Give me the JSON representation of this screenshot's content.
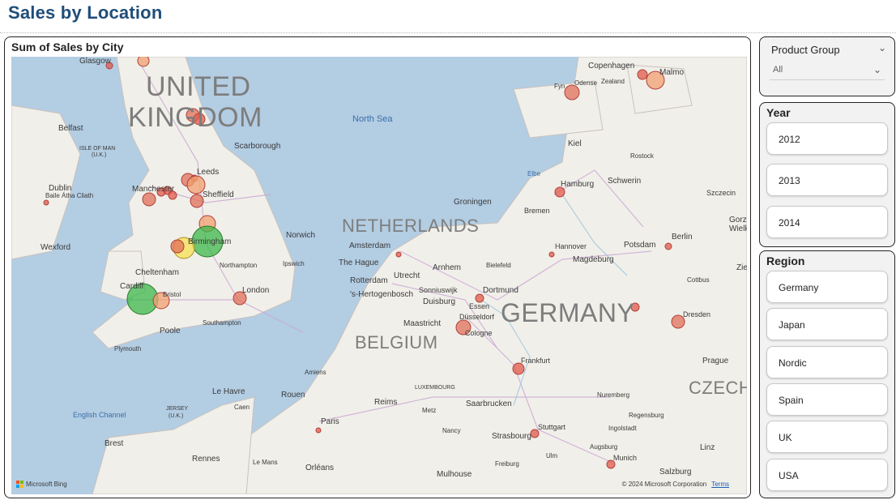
{
  "page_title": "Sales by Location",
  "map": {
    "title": "Sum of Sales by City",
    "attribution": "Microsoft Bing",
    "copyright": "© 2024 Microsoft Corporation",
    "terms": "Terms",
    "country_labels": [
      "UNITED",
      "KINGDOM",
      "NETHERLANDS",
      "BELGIUM",
      "GERMANY",
      "CZECH"
    ],
    "sea_labels": [
      "North Sea",
      "English Channel"
    ],
    "place_labels": [
      "Glasgow",
      "Belfast",
      "ISLE OF MAN",
      "(U.K.)",
      "Dublin",
      "Baile Átha Cliath",
      "Wexford",
      "Leeds",
      "Manchester",
      "Sheffield",
      "Scarborough",
      "Birmingham",
      "Norwich",
      "Northampton",
      "Ipswich",
      "Cheltenham",
      "Cardiff",
      "Bristol",
      "London",
      "Poole",
      "Southampton",
      "Plymouth",
      "Amsterdam",
      "The Hague",
      "Rotterdam",
      "Utrecht",
      "Arnhem",
      "Bielefeld",
      "'s-Hertogenbosch",
      "Sonniuswijk",
      "Dortmund",
      "Duisburg",
      "Essen",
      "Düsseldorf",
      "Maastricht",
      "Cologne",
      "Groningen",
      "Bremen",
      "Hamburg",
      "Hannover",
      "Magdeburg",
      "Potsdam",
      "Berlin",
      "Schwerin",
      "Rostock",
      "Kiel",
      "Elbe",
      "Szczecin",
      "Gorzów Wielkopolski",
      "Zielona",
      "Cottbus",
      "Dresden",
      "Odense",
      "Fyn",
      "Zealand",
      "Copenhagen",
      "Malmo",
      "Frankfurt",
      "Stuttgart",
      "Nuremberg",
      "Regensburg",
      "Ingolstadt",
      "Augsburg",
      "Munich",
      "Salzburg",
      "Linz",
      "Prague",
      "Amiens",
      "Le Havre",
      "Rouen",
      "Caen",
      "JERSEY",
      "(U.K.)",
      "Reims",
      "LUXEMBOURG",
      "Saarbrucken",
      "Metz",
      "Nancy",
      "Paris",
      "Strasbourg",
      "Freiburg",
      "Ulm",
      "Mulhouse",
      "Brest",
      "Rennes",
      "Le Mans",
      "Orléans"
    ],
    "bubble_colors": {
      "low": "#e05a4a",
      "mid": "#f0a070",
      "high": "#f5e050",
      "top": "#3cb84a"
    }
  },
  "product_group": {
    "label": "Product Group",
    "value": "All"
  },
  "year": {
    "label": "Year",
    "options": [
      "2012",
      "2013",
      "2014"
    ]
  },
  "region": {
    "label": "Region",
    "options": [
      "Germany",
      "Japan",
      "Nordic",
      "Spain",
      "UK",
      "USA"
    ]
  }
}
